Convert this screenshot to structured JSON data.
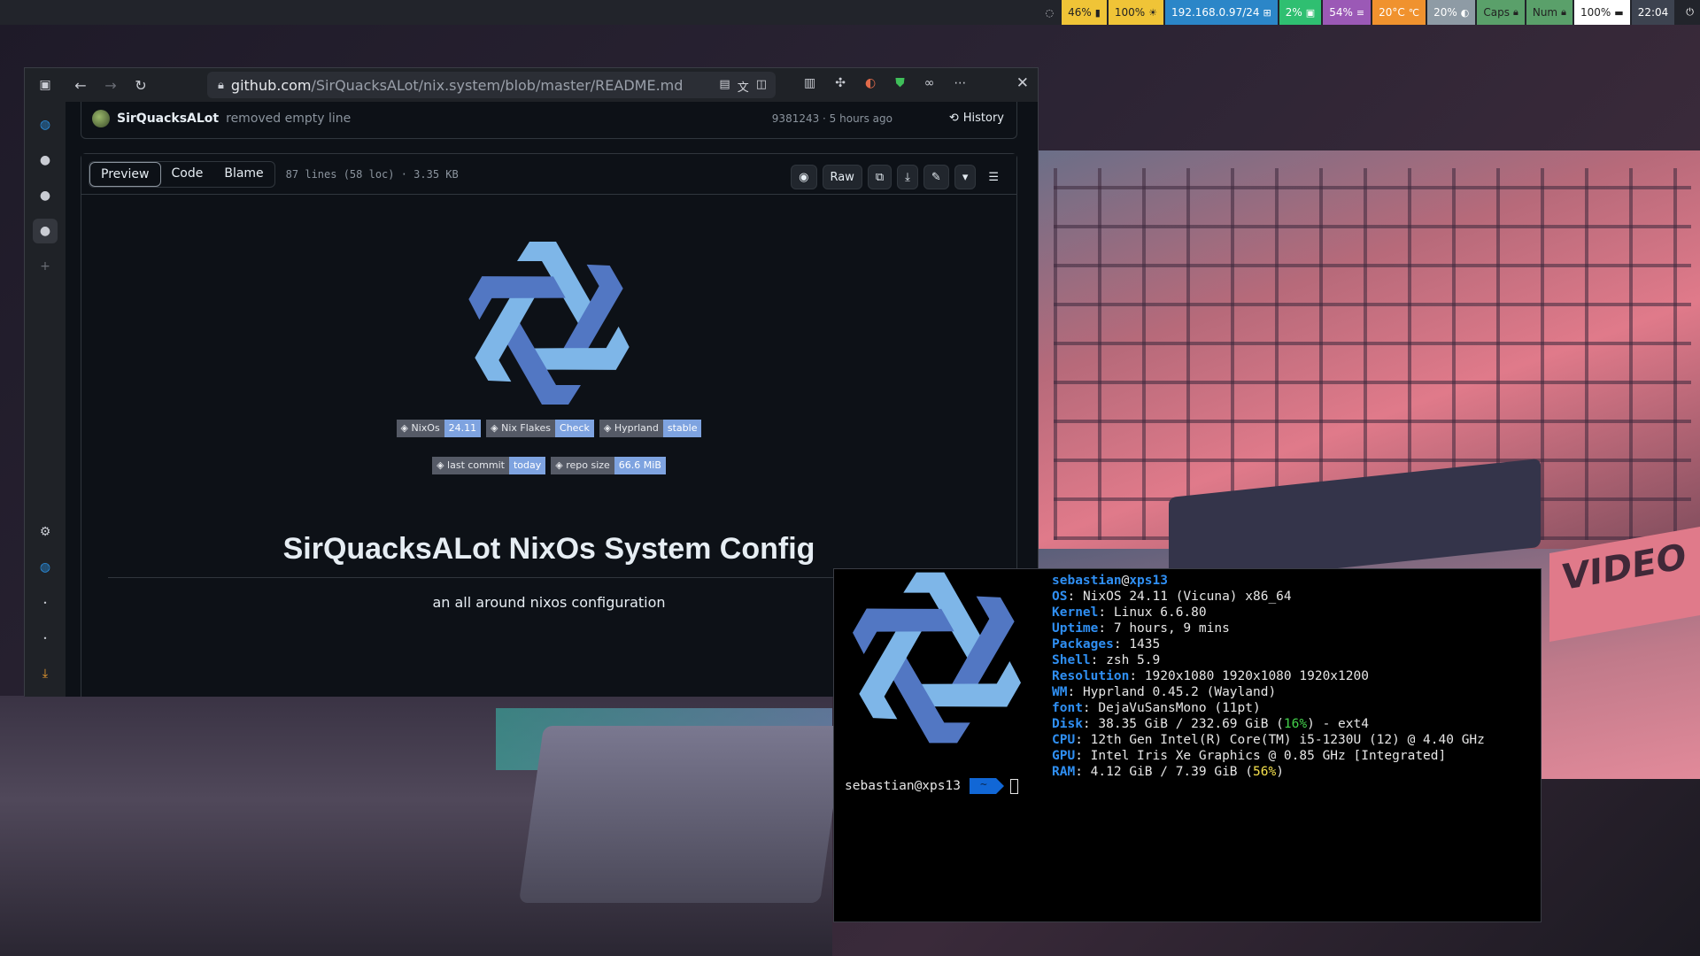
{
  "topbar": {
    "modules": [
      {
        "id": "idle",
        "icon": "eye-off-icon",
        "text": "",
        "bg": "#22242b",
        "fg": "#d0d2d8"
      },
      {
        "id": "battery",
        "icon": "battery-icon",
        "text": "46%",
        "bg": "#f0c437",
        "fg": "#222"
      },
      {
        "id": "brightness",
        "icon": "brightness-icon",
        "text": "100%",
        "bg": "#f0c437",
        "fg": "#222"
      },
      {
        "id": "network",
        "icon": "network-icon",
        "text": "192.168.0.97/24",
        "bg": "#2b86c8",
        "fg": "#fff"
      },
      {
        "id": "cpu",
        "icon": "cpu-icon",
        "text": "2%",
        "bg": "#2fbf71",
        "fg": "#fff"
      },
      {
        "id": "memory",
        "icon": "memory-icon",
        "text": "54%",
        "bg": "#9b59b6",
        "fg": "#fff"
      },
      {
        "id": "temperature",
        "icon": "thermometer-icon",
        "text": "20°C",
        "bg": "#f0922e",
        "fg": "#fff"
      },
      {
        "id": "backlight",
        "icon": "backlight-icon",
        "text": "20%",
        "bg": "#8e9ba5",
        "fg": "#fff"
      },
      {
        "id": "caps",
        "icon": "lock-icon",
        "text": "Caps",
        "bg": "#5aa06a",
        "fg": "#222"
      },
      {
        "id": "num",
        "icon": "lock-icon",
        "text": "Num",
        "bg": "#5aa06a",
        "fg": "#222"
      },
      {
        "id": "power",
        "icon": "battery-full-icon",
        "text": "100%",
        "bg": "#ffffff",
        "fg": "#222"
      },
      {
        "id": "clock",
        "icon": "",
        "text": "22:04",
        "bg": "#3d4350",
        "fg": "#fff"
      },
      {
        "id": "poweroff",
        "icon": "power-icon",
        "text": "",
        "bg": "#22242b",
        "fg": "#fff"
      }
    ]
  },
  "browser": {
    "url_domain": "github.com",
    "url_path": "/SirQuacksALot/nix.system/blob/master/README.md",
    "commit": {
      "user": "SirQuacksALot",
      "message": "removed empty line",
      "meta": "9381243 · 5 hours ago",
      "history": "History"
    },
    "file": {
      "tabs": [
        "Preview",
        "Code",
        "Blame"
      ],
      "active_tab": "Preview",
      "info": "87 lines (58 loc) · 3.35 KB",
      "raw_label": "Raw"
    },
    "readme": {
      "badges_row1": [
        {
          "label": "NixOs",
          "value": "24.11",
          "color": "#7ea3e0"
        },
        {
          "label": "Nix Flakes",
          "value": "Check",
          "color": "#7ea3e0"
        },
        {
          "label": "Hyprland",
          "value": "stable",
          "color": "#7ea3e0"
        }
      ],
      "badges_row2": [
        {
          "label": "last commit",
          "value": "today",
          "color": "#7ea3e0"
        },
        {
          "label": "repo size",
          "value": "66.6 MiB",
          "color": "#7ea3e0"
        }
      ],
      "title": "SirQuacksALot NixOs System Config",
      "subtitle": "an all around nixos configuration"
    }
  },
  "terminal": {
    "user": "sebastian",
    "host": "xps13",
    "lines": [
      {
        "k": "OS",
        "v": "NixOS 24.11 (Vicuna) x86_64"
      },
      {
        "k": "Kernel",
        "v": "Linux 6.6.80"
      },
      {
        "k": "Uptime",
        "v": "7 hours, 9 mins"
      },
      {
        "k": "Packages",
        "v": "1435"
      },
      {
        "k": "Shell",
        "v": "zsh 5.9"
      },
      {
        "k": "Resolution",
        "v": "1920x1080 1920x1080 1920x1200"
      },
      {
        "k": "WM",
        "v": "Hyprland 0.45.2 (Wayland)"
      },
      {
        "k": "font",
        "v": "DejaVuSansMono (11pt)"
      },
      {
        "k": "Disk",
        "v": "38.35 GiB / 232.69 GiB (",
        "pct": "16%",
        "pct_color": "g",
        "tail": ") - ext4"
      },
      {
        "k": "CPU",
        "v": "12th Gen Intel(R) Core(TM) i5-1230U (12) @ 4.40 GHz"
      },
      {
        "k": "GPU",
        "v": "Intel Iris Xe Graphics @ 0.85 GHz [Integrated]"
      },
      {
        "k": "RAM",
        "v": "4.12 GiB / 7.39 GiB (",
        "pct": "56%",
        "pct_color": "y",
        "tail": ")"
      }
    ],
    "prompt": "sebastian@xps13",
    "cwd": "~"
  },
  "wallpaper": {
    "plate_text": "VIDEO"
  }
}
